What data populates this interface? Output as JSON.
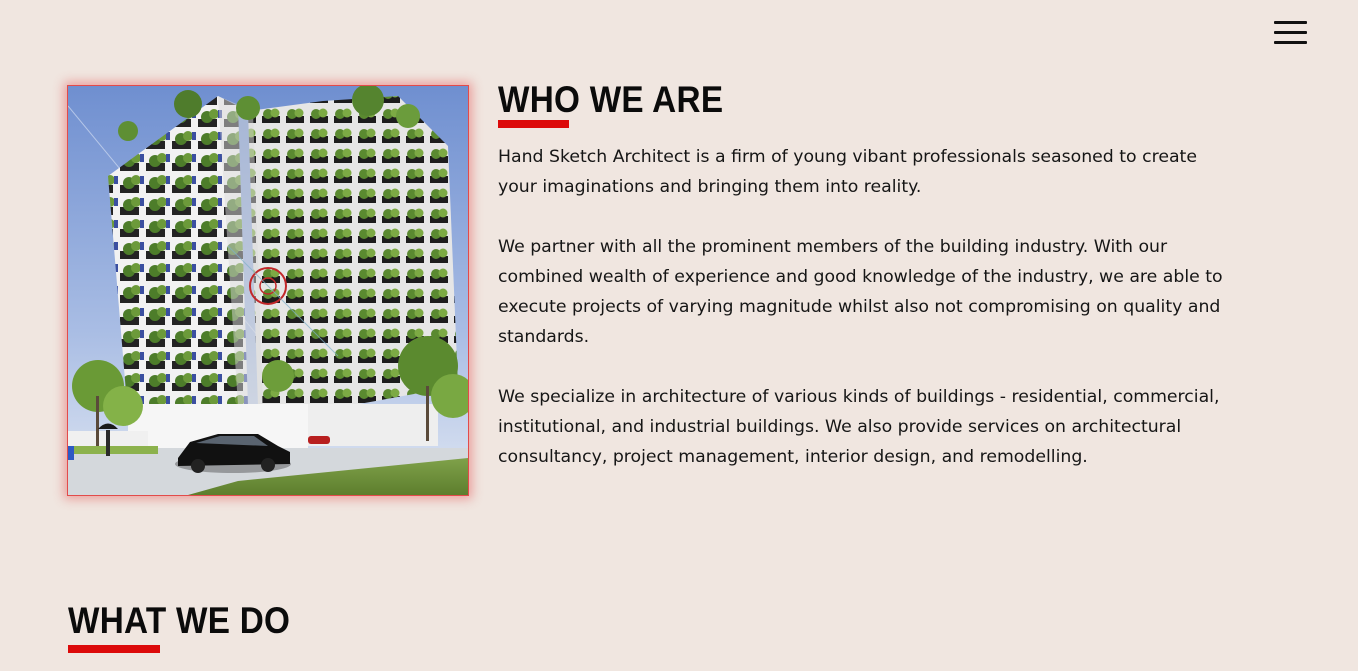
{
  "header": {
    "menu_icon": "hamburger-menu-icon"
  },
  "about": {
    "title": "WHO WE ARE",
    "image_alt": "Green high-rise residential building with balcony planters",
    "paragraphs": [
      "Hand Sketch Architect is a firm of young vibant professionals seasoned to create your imaginations and bringing them into reality.",
      "We partner with all the prominent members of the building industry. With our combined wealth of experience and good knowledge of the industry, we are able to execute projects of varying magnitude whilst also not compromising on quality and standards.",
      "We specialize in architecture of various kinds of buildings - residential, commercial, institutional, and industrial buildings. We also provide services on architectural consultancy, project management, interior design, and remodelling."
    ]
  },
  "services": {
    "title": "WHAT WE DO"
  },
  "colors": {
    "background": "#f0e6e0",
    "accent": "#dc0a0a",
    "text": "#111111"
  }
}
